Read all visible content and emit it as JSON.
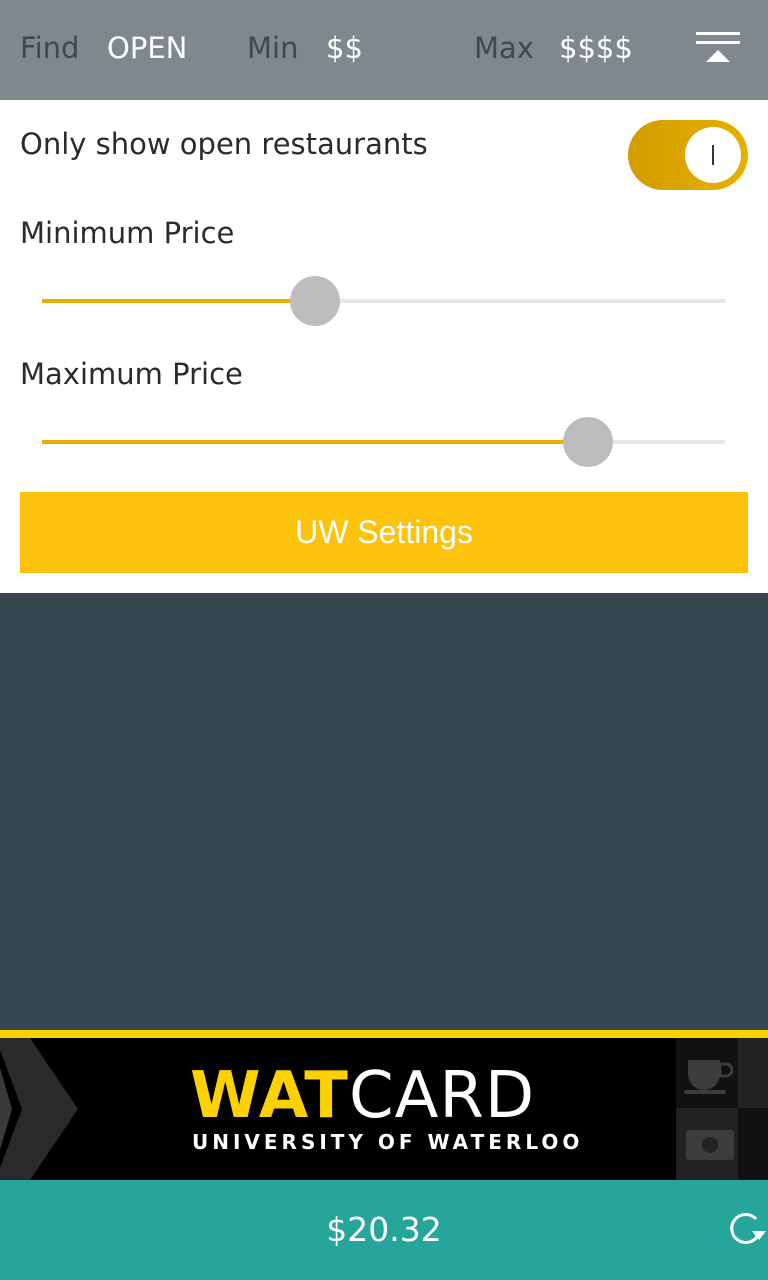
{
  "topbar": {
    "find_label": "Find",
    "find_value": "OPEN",
    "min_label": "Min",
    "min_value": "$$",
    "max_label": "Max",
    "max_value": "$$$$",
    "collapse_icon": "collapse-up-icon"
  },
  "settings": {
    "open_only_label": "Only show open restaurants",
    "open_only_enabled": true,
    "min_price_label": "Minimum Price",
    "min_price_fraction": 0.4,
    "max_price_label": "Maximum Price",
    "max_price_fraction": 0.8,
    "uw_settings_label": "UW Settings"
  },
  "banner": {
    "logo_wat": "WAT",
    "logo_card": "CARD",
    "logo_sub": "UNIVERSITY OF WATERLOO",
    "icons": [
      "coffee-cup-icon",
      "money-icon"
    ]
  },
  "balance": {
    "amount": "$20.32",
    "refresh_icon": "refresh-icon"
  },
  "colors": {
    "topbar_bg": "#7f888c",
    "accent_gold": "#fdc20c",
    "slider_fill": "#e6b000",
    "blank_area": "#37474f",
    "balance_bar": "#26a69a"
  }
}
